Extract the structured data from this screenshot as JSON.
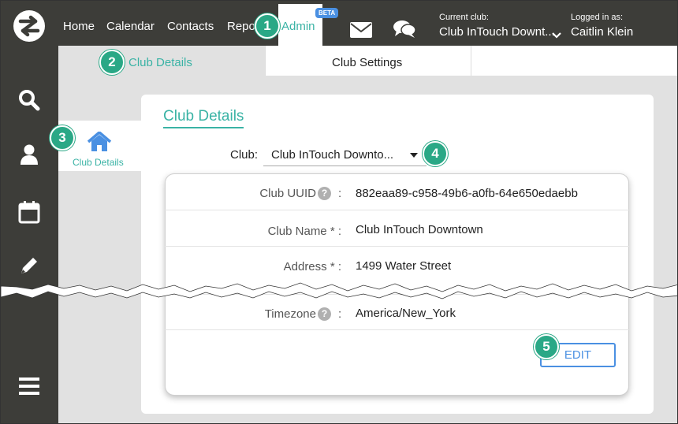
{
  "nav": {
    "links": [
      "Home",
      "Calendar",
      "Contacts",
      "Repo"
    ],
    "admin_label": "Admin",
    "beta_badge": "BETA",
    "current_club_caption": "Current club:",
    "current_club_value": "Club InTouch Downt...",
    "logged_in_caption": "Logged in as:",
    "logged_in_value": "Caitlin Klein",
    "icons": [
      "mail-icon",
      "chat-icon",
      "chevron-down-icon"
    ]
  },
  "sidebar": {
    "icons": [
      "search-icon",
      "user-icon",
      "calendar-icon",
      "pencil-icon",
      "menu-icon"
    ]
  },
  "tabs": {
    "club_details": "Club Details",
    "club_settings": "Club Settings"
  },
  "subnav": {
    "item_label": "Club Details",
    "item_icon": "home-icon"
  },
  "card": {
    "title": "Club Details",
    "club_label": "Club:",
    "club_select_value": "Club InTouch Downto...",
    "fields": [
      {
        "label": "Club UUID",
        "value": "882eaa89-c958-49b6-a0fb-64e650edaebb"
      },
      {
        "label": "Club Name * :",
        "value": "Club InTouch Downtown"
      },
      {
        "label": "Address * :",
        "value": "1499 Water Street"
      },
      {
        "label": "Timezone",
        "value": "America/New_York"
      }
    ],
    "colon": ":",
    "help_glyph": "?",
    "edit_label": "EDIT"
  },
  "markers": [
    "1",
    "2",
    "3",
    "4",
    "5"
  ],
  "colors": {
    "dark_bar": "#3d3d39",
    "accent_teal": "#3ab3a5",
    "marker_green": "#2aa886",
    "edit_blue": "#4a90e2",
    "background_gray": "#e1e1e1"
  }
}
